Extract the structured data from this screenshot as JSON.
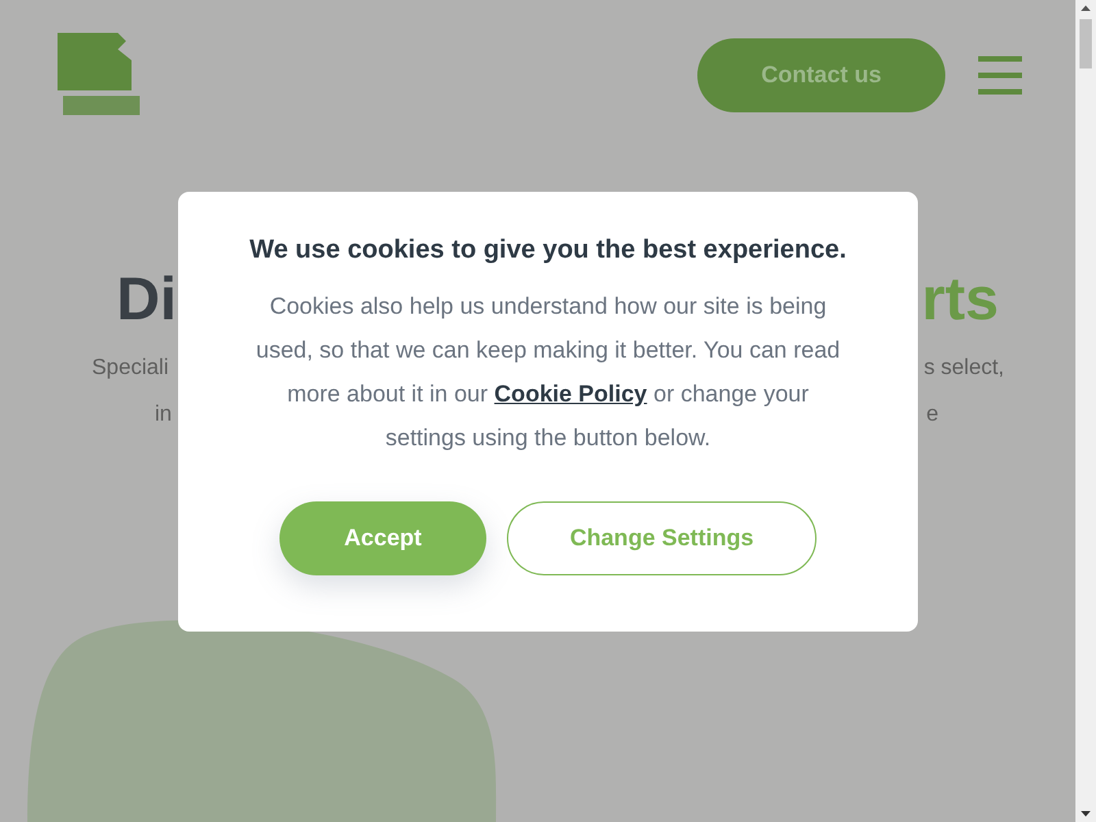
{
  "header": {
    "contact_button": "Contact us"
  },
  "hero": {
    "heading_left": "Di",
    "heading_right": "rts",
    "subtext_lines": [
      {
        "left": "Speciali",
        "right": "s select,"
      },
      {
        "left": "in",
        "right": "e"
      }
    ]
  },
  "cookie_dialog": {
    "title": "We use cookies to give you the best experience.",
    "body": "Cookies also help us understand how our site is being used, so that we can keep making it better. You can read more about it in our",
    "link": "Cookie Policy",
    "body_end": "or change your settings using the button below.",
    "buttons": [
      {
        "label": "Accept",
        "kind": "primary"
      },
      {
        "label": "Change Settings",
        "kind": "outline"
      }
    ]
  }
}
